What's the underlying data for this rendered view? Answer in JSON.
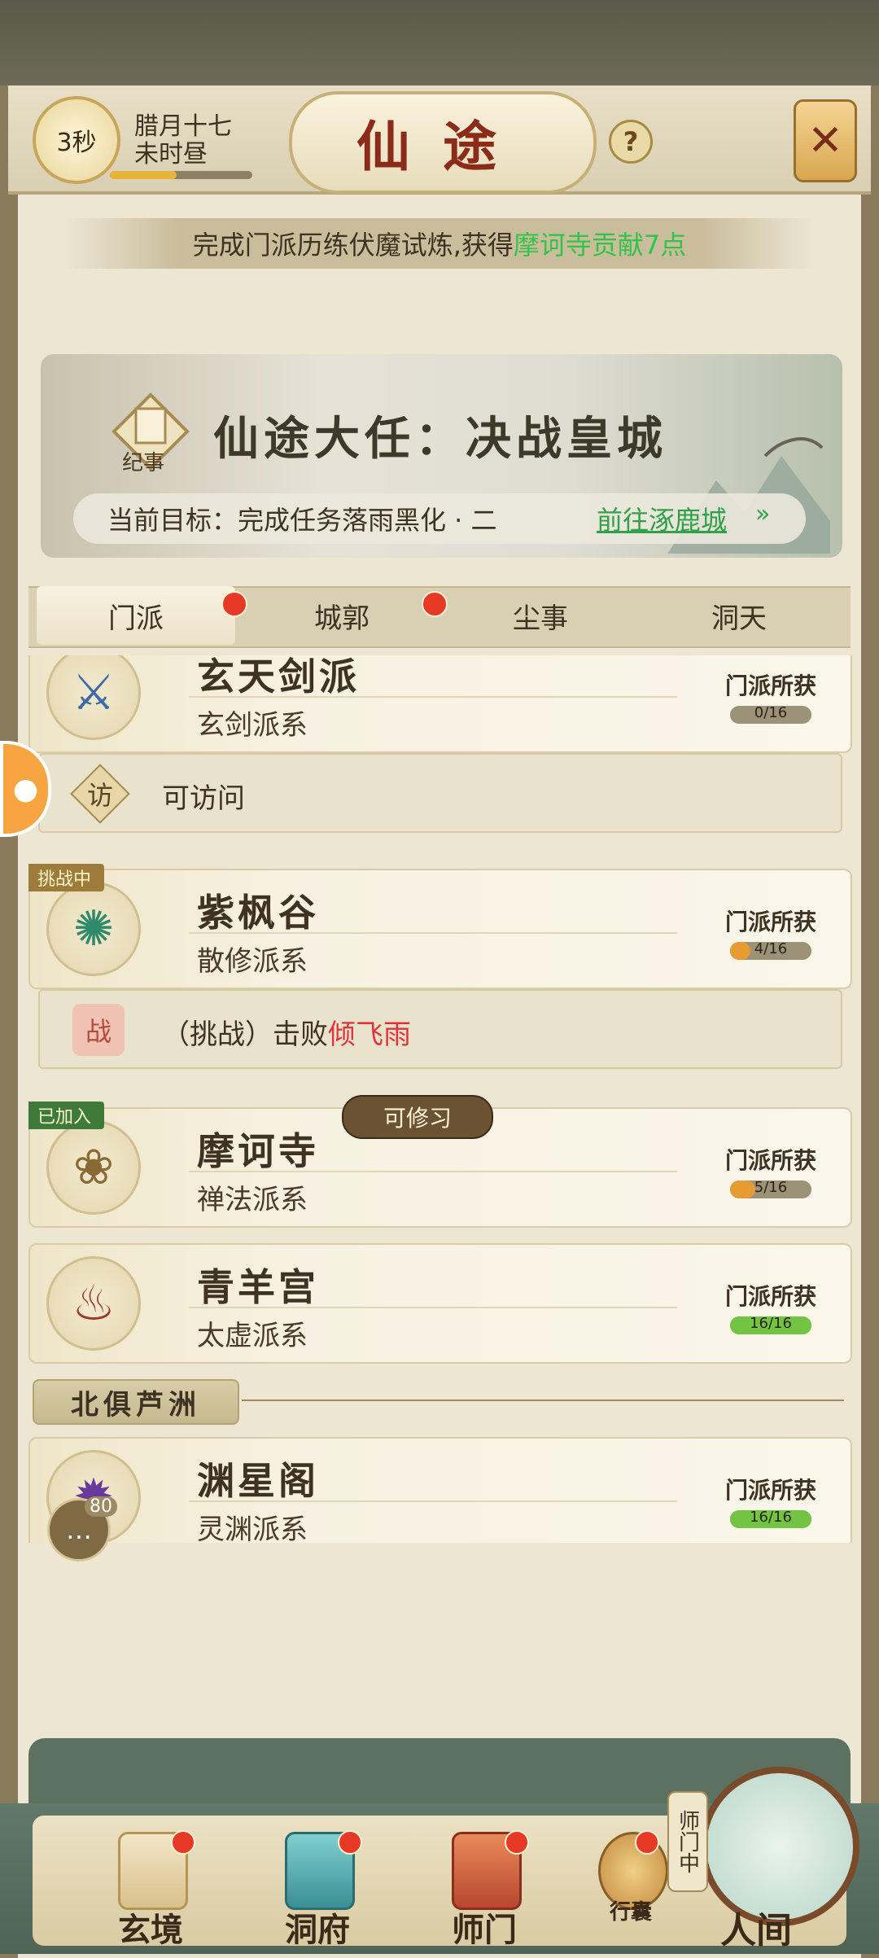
{
  "header": {
    "timer": "3秒",
    "date_line1": "腊月十七",
    "date_line2": "未时昼",
    "title": "仙途",
    "help": "?",
    "close": "✕"
  },
  "notice": {
    "prefix": "完成门派历练伏魔试炼,获得",
    "highlight": "摩诃寺贡献7点"
  },
  "quest": {
    "badge": "纪事",
    "title": "仙途大任：决战皇城",
    "target": "当前目标：完成任务落雨黑化 · 二",
    "link": "前往涿鹿城",
    "arrow": "»"
  },
  "tabs": [
    {
      "label": "门派"
    },
    {
      "label": "城郭"
    },
    {
      "label": "尘事"
    },
    {
      "label": "洞天"
    }
  ],
  "sects": [
    {
      "name": "玄天剑派",
      "school": "玄剑派系",
      "reward_label": "门派所获",
      "progress": "0/16",
      "ratio": 0.0,
      "icon": "sword-emblem-icon",
      "action_icon": "访",
      "action": "可访问"
    },
    {
      "tag": "挑战中",
      "name": "紫枫谷",
      "school": "散修派系",
      "reward_label": "门派所获",
      "progress": "4/16",
      "ratio": 0.25,
      "icon": "fan-leaf-icon",
      "action_icon": "战",
      "action_prefix": "（挑战）击败",
      "action_target": "倾飞雨"
    },
    {
      "tag": "已加入",
      "name": "摩诃寺",
      "school": "禅法派系",
      "reward_label": "门派所获",
      "progress": "5/16",
      "ratio": 0.3125,
      "icon": "lotus-icon"
    },
    {
      "name": "青羊宫",
      "school": "太虚派系",
      "reward_label": "门派所获",
      "progress": "16/16",
      "ratio": 1.0,
      "icon": "tripod-icon"
    }
  ],
  "tooltip": "可修习",
  "region": "北俱芦洲",
  "sects_region2": [
    {
      "name": "渊星阁",
      "school": "灵渊派系",
      "reward_label": "门派所获",
      "progress": "16/16",
      "ratio": 1.0,
      "icon": "star-crown-icon"
    }
  ],
  "chat": {
    "count": "80"
  },
  "bottom_nav": [
    {
      "label": "玄境"
    },
    {
      "label": "洞府"
    },
    {
      "label": "师门"
    },
    {
      "label": "行囊"
    },
    {
      "label": "人间"
    }
  ],
  "shimen_tag": "师门中",
  "colors": {
    "accent_green": "#33c24a",
    "alert_red": "#e63a26",
    "title_red": "#8b2c1a"
  }
}
